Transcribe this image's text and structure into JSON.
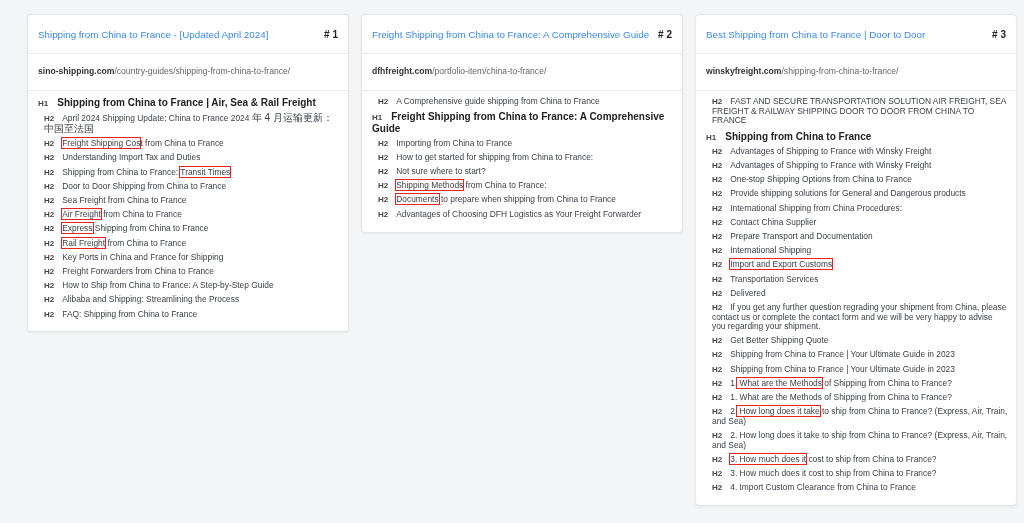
{
  "cards": [
    {
      "title": "Shipping from China to France - [Updated April 2024]",
      "rank": "# 1",
      "domain": "sino-shipping.com",
      "path": "/country-guides/shipping-from-china-to-france/",
      "headings": [
        {
          "kind": "h1",
          "tag": "H1",
          "parts": [
            {
              "text": "Shipping from China to France | Air, Sea & Rail Freight",
              "highlighted": false
            }
          ]
        },
        {
          "kind": "h2",
          "tag": "H2",
          "parts": [
            {
              "text": "April 2024 Shipping Update: China to France 2024 ",
              "highlighted": false
            },
            {
              "text": "年 4 月运输更新：中国至法国",
              "highlighted": false
            }
          ]
        },
        {
          "kind": "h2",
          "tag": "H2",
          "parts": [
            {
              "text": "Freight Shipping Cos",
              "highlighted": true
            },
            {
              "text": "t from China to France",
              "highlighted": false
            }
          ]
        },
        {
          "kind": "h2",
          "tag": "H2",
          "parts": [
            {
              "text": "Understanding Import Tax and Duties",
              "highlighted": false
            }
          ]
        },
        {
          "kind": "h2",
          "tag": "H2",
          "parts": [
            {
              "text": "Shipping from China to France: ",
              "highlighted": false
            },
            {
              "text": "Transit Times",
              "highlighted": true
            }
          ]
        },
        {
          "kind": "h2",
          "tag": "H2",
          "parts": [
            {
              "text": "Door to Door Shipping from China to France",
              "highlighted": false
            }
          ]
        },
        {
          "kind": "h2",
          "tag": "H2",
          "parts": [
            {
              "text": "Sea Freight from China to France",
              "highlighted": false
            }
          ]
        },
        {
          "kind": "h2",
          "tag": "H2",
          "parts": [
            {
              "text": "Air Freight",
              "highlighted": true
            },
            {
              "text": " from China to France",
              "highlighted": false
            }
          ]
        },
        {
          "kind": "h2",
          "tag": "H2",
          "parts": [
            {
              "text": "Express",
              "highlighted": true
            },
            {
              "text": " Shipping from China to France",
              "highlighted": false
            }
          ]
        },
        {
          "kind": "h2",
          "tag": "H2",
          "parts": [
            {
              "text": "Rail Freight",
              "highlighted": true
            },
            {
              "text": " from China to France",
              "highlighted": false
            }
          ]
        },
        {
          "kind": "h2",
          "tag": "H2",
          "parts": [
            {
              "text": "Key Ports in China and France for Shipping",
              "highlighted": false
            }
          ]
        },
        {
          "kind": "h2",
          "tag": "H2",
          "parts": [
            {
              "text": "Freight Forwarders from China to France",
              "highlighted": false
            }
          ]
        },
        {
          "kind": "h2",
          "tag": "H2",
          "parts": [
            {
              "text": "How to Ship from China to France: A Step-by-Step Guide",
              "highlighted": false
            }
          ]
        },
        {
          "kind": "h2",
          "tag": "H2",
          "parts": [
            {
              "text": "Alibaba and Shipping: Streamlining the Process",
              "highlighted": false
            }
          ]
        },
        {
          "kind": "h2",
          "tag": "H2",
          "parts": [
            {
              "text": "FAQ: Shipping from China to France",
              "highlighted": false
            }
          ]
        }
      ]
    },
    {
      "title": "Freight Shipping from China to France: A Comprehensive Guide",
      "rank": "# 2",
      "domain": "dfhfreight.com",
      "path": "/portfolio-item/china-to-france/",
      "headings": [
        {
          "kind": "h2",
          "tag": "H2",
          "parts": [
            {
              "text": "A Comprehensive guide shipping from China to France",
              "highlighted": false
            }
          ]
        },
        {
          "kind": "h1",
          "tag": "H1",
          "parts": [
            {
              "text": "Freight Shipping from China to France: A Comprehensive Guide",
              "highlighted": false
            }
          ]
        },
        {
          "kind": "h2",
          "tag": "H2",
          "parts": [
            {
              "text": "Importing from China to France",
              "highlighted": false
            }
          ]
        },
        {
          "kind": "h2",
          "tag": "H2",
          "parts": [
            {
              "text": "How to get started for shipping from China to France:",
              "highlighted": false
            }
          ]
        },
        {
          "kind": "h2",
          "tag": "H2",
          "parts": [
            {
              "text": "Not sure where to start?",
              "highlighted": false
            }
          ]
        },
        {
          "kind": "h2",
          "tag": "H2",
          "parts": [
            {
              "text": "Shipping Methods",
              "highlighted": true
            },
            {
              "text": " from China to France:",
              "highlighted": false
            }
          ]
        },
        {
          "kind": "h2",
          "tag": "H2",
          "parts": [
            {
              "text": "Documents",
              "highlighted": true
            },
            {
              "text": " to prepare when shipping from China to France",
              "highlighted": false
            }
          ]
        },
        {
          "kind": "h2",
          "tag": "H2",
          "parts": [
            {
              "text": "Advantages of Choosing DFH Logistics as Your Freight Forwarder",
              "highlighted": false
            }
          ]
        }
      ]
    },
    {
      "title": "Best Shipping from China to France | Door to Door",
      "rank": "# 3",
      "domain": "winskyfreight.com",
      "path": "/shipping-from-china-to-france/",
      "headings": [
        {
          "kind": "h2",
          "tag": "H2",
          "parts": [
            {
              "text": "FAST AND SECURE TRANSPORTATION SOLUTION AIR FREIGHT, SEA FREIGHT & RAILWAY SHIPPING DOOR TO DOOR FROM CHINA TO FRANCE",
              "highlighted": false
            }
          ]
        },
        {
          "kind": "h1",
          "tag": "H1",
          "parts": [
            {
              "text": "Shipping from China to France",
              "highlighted": false
            }
          ]
        },
        {
          "kind": "h2",
          "tag": "H2",
          "parts": [
            {
              "text": "Advantages of Shipping to France with Winsky Freight",
              "highlighted": false
            }
          ]
        },
        {
          "kind": "h2",
          "tag": "H2",
          "parts": [
            {
              "text": "Advantages of Shipping to France with Winsky Freight",
              "highlighted": false
            }
          ]
        },
        {
          "kind": "h2",
          "tag": "H2",
          "parts": [
            {
              "text": "One-stop Shipping Options from China to France",
              "highlighted": false
            }
          ]
        },
        {
          "kind": "h2",
          "tag": "H2",
          "parts": [
            {
              "text": "Provide shipping solutions for General and Dangerous products",
              "highlighted": false
            }
          ]
        },
        {
          "kind": "h2",
          "tag": "H2",
          "parts": [
            {
              "text": "International Shipping from China Procedures:",
              "highlighted": false
            }
          ]
        },
        {
          "kind": "h2",
          "tag": "H2",
          "parts": [
            {
              "text": "Contact China Supplier",
              "highlighted": false
            }
          ]
        },
        {
          "kind": "h2",
          "tag": "H2",
          "parts": [
            {
              "text": "Prepare Transport and Documentation",
              "highlighted": false
            }
          ]
        },
        {
          "kind": "h2",
          "tag": "H2",
          "parts": [
            {
              "text": "International Shipping",
              "highlighted": false
            }
          ]
        },
        {
          "kind": "h2",
          "tag": "H2",
          "parts": [
            {
              "text": "Import and Export Customs",
              "highlighted": true
            }
          ]
        },
        {
          "kind": "h2",
          "tag": "H2",
          "parts": [
            {
              "text": "Transportation Services",
              "highlighted": false
            }
          ]
        },
        {
          "kind": "h2",
          "tag": "H2",
          "parts": [
            {
              "text": "Delivered",
              "highlighted": false
            }
          ]
        },
        {
          "kind": "h2",
          "tag": "H2",
          "parts": [
            {
              "text": "If you get any further question regrading your shipment from China, please contact us or complete the contact form and we will be very happy to advise you regarding your shipment.",
              "highlighted": false
            }
          ]
        },
        {
          "kind": "h2",
          "tag": "H2",
          "parts": [
            {
              "text": "Get Better Shipping Quote",
              "highlighted": false
            }
          ]
        },
        {
          "kind": "h2",
          "tag": "H2",
          "parts": [
            {
              "text": "Shipping from China to France | Your Ultimate Guide in 2023",
              "highlighted": false
            }
          ]
        },
        {
          "kind": "h2",
          "tag": "H2",
          "parts": [
            {
              "text": "Shipping from China to France | Your Ultimate Guide in 2023",
              "highlighted": false
            }
          ]
        },
        {
          "kind": "h2",
          "tag": "H2",
          "parts": [
            {
              "text": "1.",
              "highlighted": false
            },
            {
              "text": " What are the Methods",
              "highlighted": true
            },
            {
              "text": " of Shipping from China to France?",
              "highlighted": false
            }
          ]
        },
        {
          "kind": "h2",
          "tag": "H2",
          "parts": [
            {
              "text": "1. What are the Methods of Shipping from China to France?",
              "highlighted": false
            }
          ]
        },
        {
          "kind": "h2",
          "tag": "H2",
          "parts": [
            {
              "text": "2.",
              "highlighted": false
            },
            {
              "text": " How long does it take",
              "highlighted": true
            },
            {
              "text": " to ship from China to France? (Express, Air, Train, and Sea)",
              "highlighted": false
            }
          ]
        },
        {
          "kind": "h2",
          "tag": "H2",
          "parts": [
            {
              "text": "2. How long does it take to ship from China to France? (Express, Air, Train, and Sea)",
              "highlighted": false
            }
          ]
        },
        {
          "kind": "h2",
          "tag": "H2",
          "parts": [
            {
              "text": "3. How much does it",
              "highlighted": true
            },
            {
              "text": " cost to ship from China to France?",
              "highlighted": false
            }
          ]
        },
        {
          "kind": "h2",
          "tag": "H2",
          "parts": [
            {
              "text": "3. How much does it cost to ship from China to France?",
              "highlighted": false
            }
          ]
        },
        {
          "kind": "h2",
          "tag": "H2",
          "parts": [
            {
              "text": "4. Import Custom Clearance from China to France",
              "highlighted": false
            }
          ]
        }
      ]
    }
  ]
}
